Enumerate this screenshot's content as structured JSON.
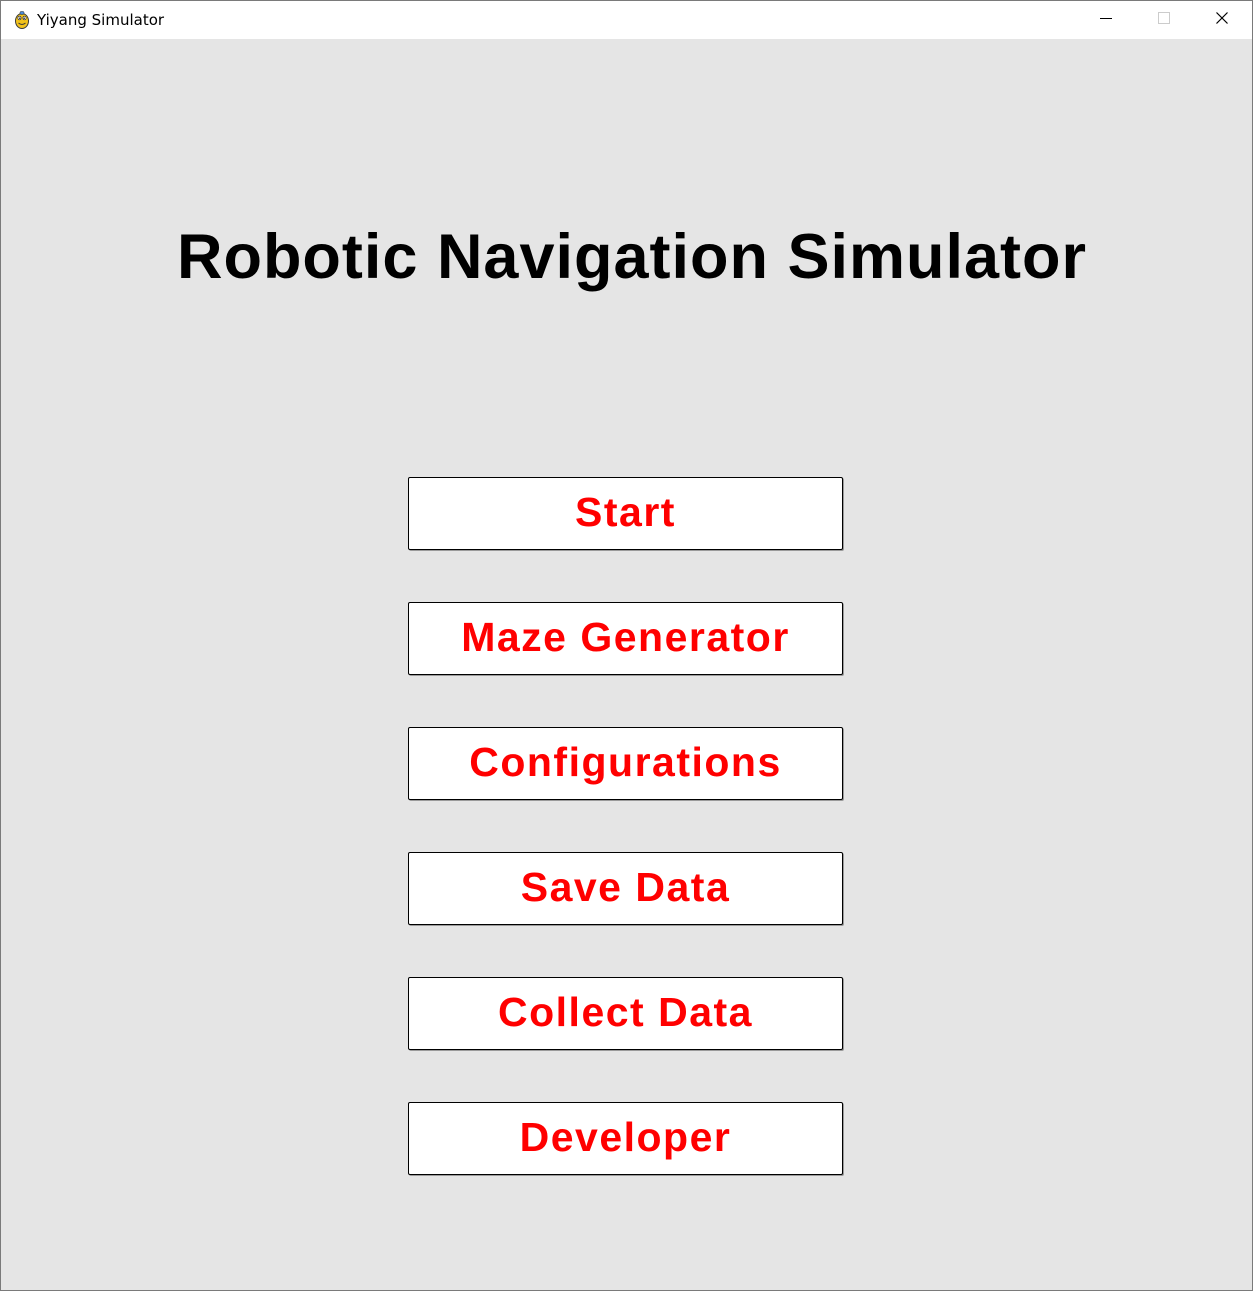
{
  "window": {
    "title": "Yiyang Simulator",
    "app_icon": "pygame-snake-icon",
    "controls": {
      "minimize_icon": "minimize-icon",
      "maximize_icon": "maximize-icon",
      "close_icon": "close-icon"
    }
  },
  "main": {
    "heading": "Robotic Navigation Simulator",
    "buttons": [
      {
        "id": "start",
        "label": "Start"
      },
      {
        "id": "maze-generator",
        "label": "Maze Generator"
      },
      {
        "id": "configurations",
        "label": "Configurations"
      },
      {
        "id": "save-data",
        "label": "Save Data"
      },
      {
        "id": "collect-data",
        "label": "Collect Data"
      },
      {
        "id": "developer",
        "label": "Developer"
      }
    ]
  },
  "colors": {
    "background": "#e5e5e5",
    "heading_text": "#000000",
    "button_background": "#ffffff",
    "button_text": "#ff0000",
    "button_border": "#000000"
  }
}
